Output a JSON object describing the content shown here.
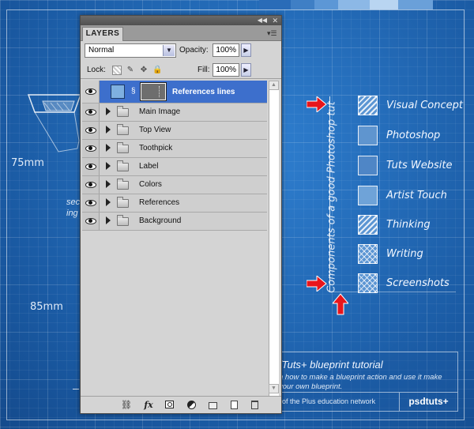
{
  "blueprint": {
    "dim_75": "75mm",
    "dim_85": "85mm",
    "left_note_line1": "sec",
    "left_note_line2": "ing",
    "vertical_text": "Components of a good Photoshop tut",
    "legend": [
      {
        "label": "Visual Concept",
        "style": "diag"
      },
      {
        "label": "Photoshop",
        "style": "solid",
        "color": "#5f95cf"
      },
      {
        "label": "Tuts Website",
        "style": "solid",
        "color": "#4f86c6"
      },
      {
        "label": "Artist Touch",
        "style": "solid",
        "color": "#6fa3d8"
      },
      {
        "label": "Thinking",
        "style": "diag"
      },
      {
        "label": "Writing",
        "style": "cross"
      },
      {
        "label": "Screenshots",
        "style": "cross"
      }
    ],
    "title_block": {
      "title": "/Tuts+ blueprint tutorial",
      "subtitle": "n how to make a blueprint action and use it make your own blueprint.",
      "network": "of the Plus education network",
      "logo": "psdtuts+"
    },
    "colors": {
      "background": "#1d63b0",
      "arrow": "#e8151b",
      "selection": "#3d6fcc"
    }
  },
  "panel": {
    "tab_label": "LAYERS",
    "collapse_icon": "double-arrow-icon",
    "close_icon": "close-icon",
    "blend_mode": "Normal",
    "opacity_label": "Opacity:",
    "opacity_value": "100%",
    "lock_label": "Lock:",
    "fill_label": "Fill:",
    "fill_value": "100%",
    "layers": [
      {
        "name": "References lines",
        "selected": true
      },
      {
        "name": "Main Image"
      },
      {
        "name": "Top View"
      },
      {
        "name": "Toothpick"
      },
      {
        "name": "Label"
      },
      {
        "name": "Colors"
      },
      {
        "name": "References"
      },
      {
        "name": "Background"
      }
    ],
    "bottom_icons": [
      "link-icon",
      "fx-icon",
      "mask-icon",
      "adjustment-icon",
      "group-icon",
      "new-layer-icon",
      "trash-icon"
    ],
    "fx_text": "fx"
  }
}
